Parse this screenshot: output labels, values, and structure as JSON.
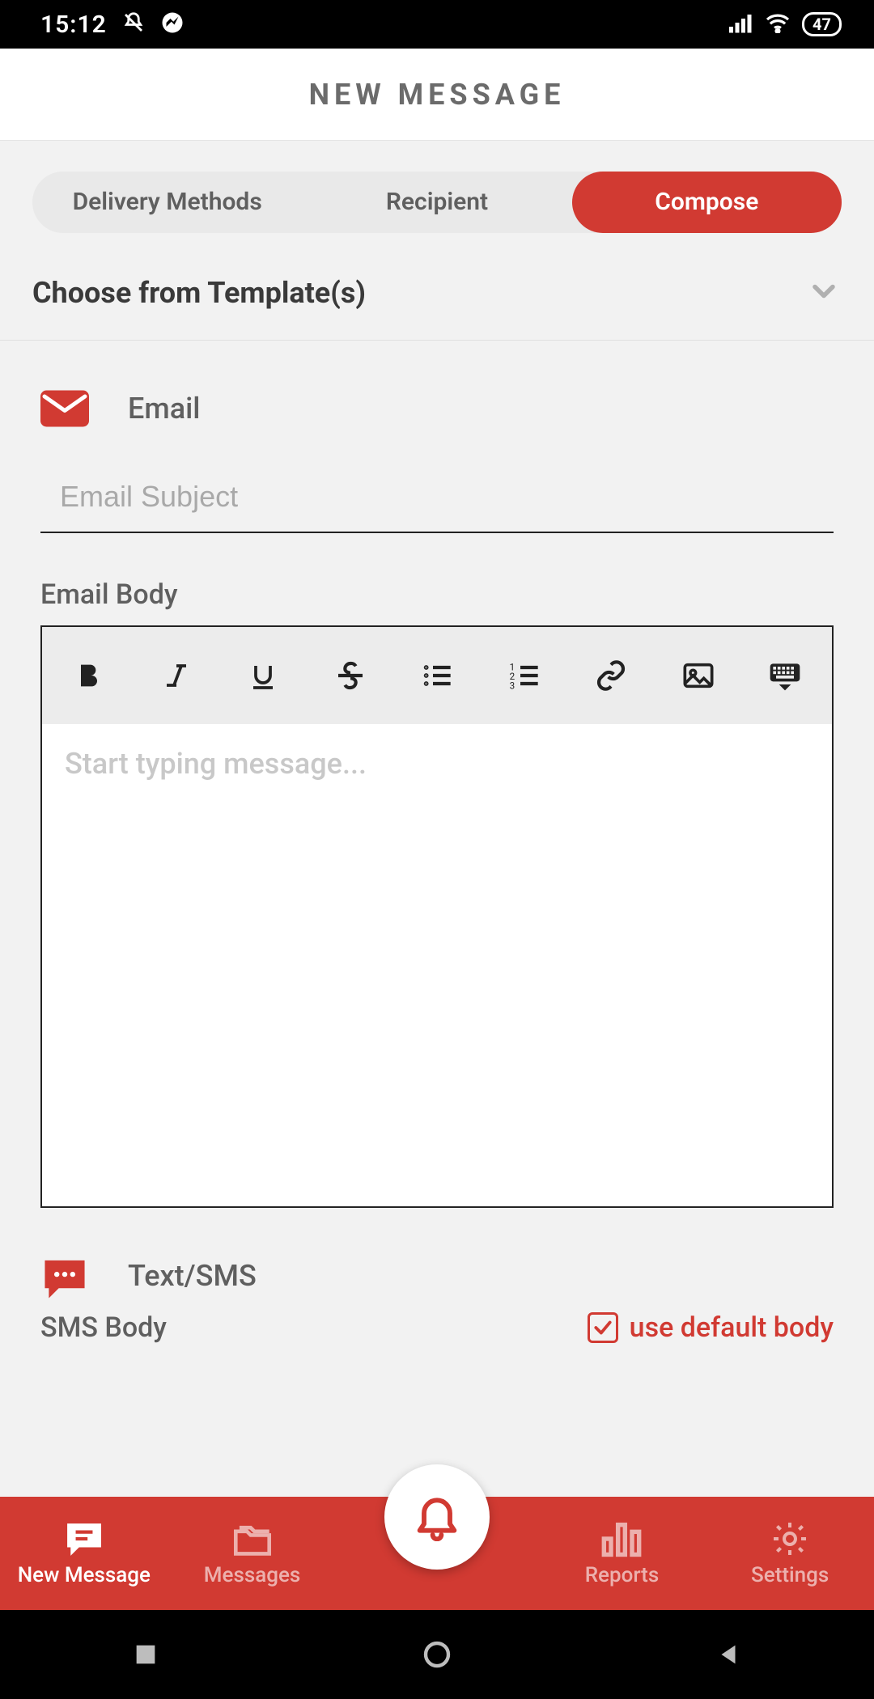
{
  "status": {
    "time": "15:12",
    "battery": "47"
  },
  "header": {
    "title": "NEW MESSAGE"
  },
  "tabs": {
    "delivery": "Delivery Methods",
    "recipient": "Recipient",
    "compose": "Compose"
  },
  "template": {
    "label": "Choose from Template(s)"
  },
  "email": {
    "label": "Email",
    "subject_placeholder": "Email Subject",
    "body_label": "Email Body",
    "editor_placeholder": "Start typing message..."
  },
  "sms": {
    "label": "Text/SMS",
    "body_label": "SMS Body",
    "default_body_label": "use default body"
  },
  "nav": {
    "new_message": "New Message",
    "messages": "Messages",
    "reports": "Reports",
    "settings": "Settings"
  },
  "colors": {
    "accent": "#d13a32",
    "bg": "#f2f2f2"
  }
}
